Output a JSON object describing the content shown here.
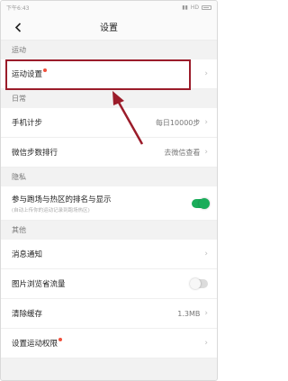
{
  "status_bar": {
    "left": "下午6:43",
    "right": "HD"
  },
  "nav": {
    "title": "设置"
  },
  "sections": {
    "sport": {
      "header": "运动",
      "items": [
        {
          "label": "运动设置"
        }
      ]
    },
    "daily": {
      "header": "日常",
      "items": [
        {
          "label": "手机计步",
          "value": "每日10000步"
        },
        {
          "label": "微信步数排行",
          "value": "去微信查看"
        }
      ]
    },
    "privacy": {
      "header": "隐私",
      "item": {
        "label": "参与跑场与热区的排名与显示",
        "sub": "(自动上传你的运动记录到跑场热区)",
        "toggle_on": true
      }
    },
    "other": {
      "header": "其他",
      "items": [
        {
          "label": "消息通知"
        },
        {
          "label": "图片浏览省流量",
          "toggle_on": false
        },
        {
          "label": "清除缓存",
          "value": "1.3MB"
        },
        {
          "label": "设置运动权限"
        }
      ]
    }
  },
  "colors": {
    "accent": "#1aad5a",
    "dot": "#f0503c",
    "highlight": "#9b1c2a"
  }
}
